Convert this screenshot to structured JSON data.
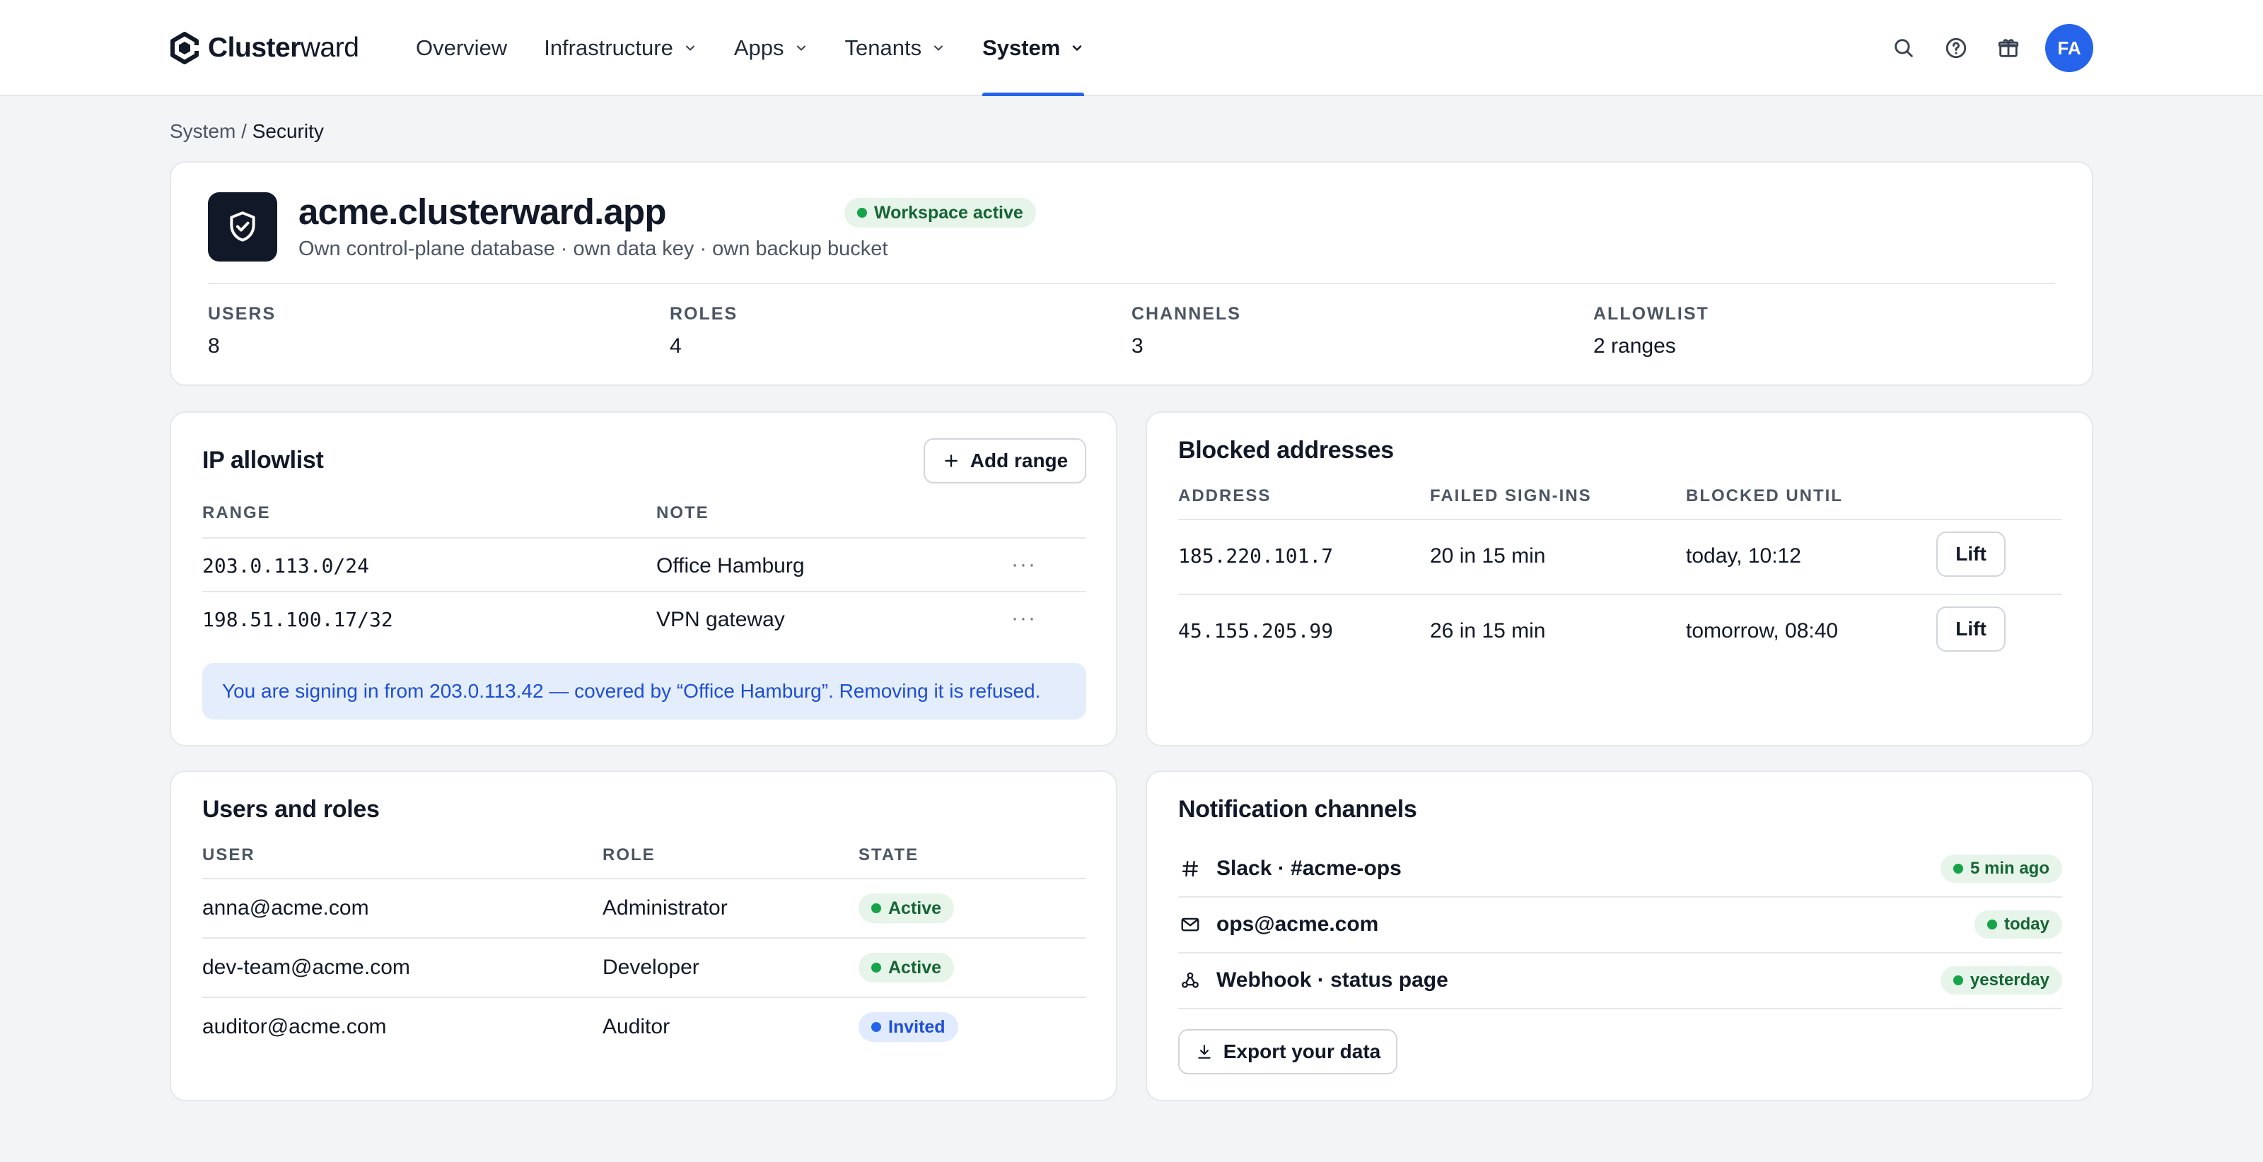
{
  "app": {
    "brand_bold": "Cluster",
    "brand_light": "ward",
    "accent": "#2563eb"
  },
  "nav": {
    "items": [
      {
        "label": "Overview",
        "has_menu": false
      },
      {
        "label": "Infrastructure",
        "has_menu": true
      },
      {
        "label": "Apps",
        "has_menu": true
      },
      {
        "label": "Tenants",
        "has_menu": true
      },
      {
        "label": "System",
        "has_menu": true,
        "active": true
      }
    ],
    "icons": [
      "search-icon",
      "help-icon",
      "gift-icon"
    ],
    "avatar_initials": "FA"
  },
  "breadcrumb": {
    "parent": "System",
    "separator": " / ",
    "current": "Security"
  },
  "workspace": {
    "name": "acme.clusterward.app",
    "status": "Workspace active",
    "description": "Own control-plane database · own data key · own backup bucket",
    "stats": [
      {
        "label": "USERS",
        "value": "8"
      },
      {
        "label": "ROLES",
        "value": "4"
      },
      {
        "label": "CHANNELS",
        "value": "3"
      },
      {
        "label": "ALLOWLIST",
        "value": "2 ranges"
      }
    ]
  },
  "allowlist": {
    "title": "IP allowlist",
    "add_label": "Add range",
    "columns": [
      "RANGE",
      "NOTE"
    ],
    "rows": [
      {
        "range": "203.0.113.0/24",
        "note": "Office Hamburg",
        "more": "···"
      },
      {
        "range": "198.51.100.17/32",
        "note": "VPN gateway",
        "more": "···"
      }
    ],
    "notice": "You are signing in from 203.0.113.42 — covered by “Office Hamburg”. Removing it is refused."
  },
  "blocked": {
    "title": "Blocked addresses",
    "columns": [
      "ADDRESS",
      "FAILED SIGN-INS",
      "BLOCKED UNTIL"
    ],
    "rows": [
      {
        "address": "185.220.101.7",
        "failed": "20 in 15 min",
        "until": "today, 10:12",
        "action": "Lift"
      },
      {
        "address": "45.155.205.99",
        "failed": "26 in 15 min",
        "until": "tomorrow, 08:40",
        "action": "Lift"
      }
    ]
  },
  "users": {
    "title": "Users and roles",
    "columns": [
      "USER",
      "ROLE",
      "STATE"
    ],
    "rows": [
      {
        "user": "anna@acme.com",
        "role": "Administrator",
        "state": "Active",
        "state_color": "green"
      },
      {
        "user": "dev-team@acme.com",
        "role": "Developer",
        "state": "Active",
        "state_color": "green"
      },
      {
        "user": "auditor@acme.com",
        "role": "Auditor",
        "state": "Invited",
        "state_color": "blue"
      }
    ]
  },
  "channels": {
    "title": "Notification channels",
    "rows": [
      {
        "icon": "hash-icon",
        "name": "Slack · #acme-ops",
        "last": "5 min ago"
      },
      {
        "icon": "mail-icon",
        "name": "ops@acme.com",
        "last": "today"
      },
      {
        "icon": "webhook-icon",
        "name": "Webhook · status page",
        "last": "yesterday"
      }
    ],
    "export_label": "Export your data"
  }
}
